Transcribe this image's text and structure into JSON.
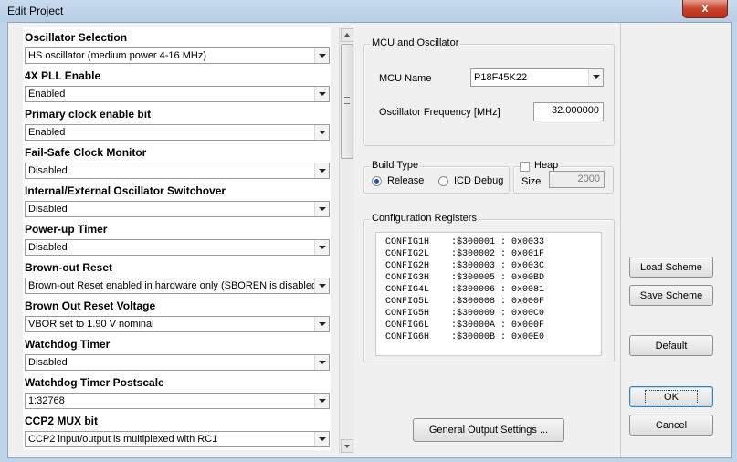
{
  "window": {
    "title": "Edit Project",
    "close_label": "x"
  },
  "options": [
    {
      "label": "Oscillator Selection",
      "value": "HS oscillator (medium power 4-16 MHz)"
    },
    {
      "label": "4X PLL Enable",
      "value": "Enabled"
    },
    {
      "label": "Primary clock enable bit",
      "value": "Enabled"
    },
    {
      "label": "Fail-Safe Clock Monitor",
      "value": "Disabled"
    },
    {
      "label": "Internal/External Oscillator Switchover",
      "value": "Disabled"
    },
    {
      "label": "Power-up Timer",
      "value": "Disabled"
    },
    {
      "label": "Brown-out Reset",
      "value": "Brown-out Reset enabled in hardware only (SBOREN is disabled)"
    },
    {
      "label": "Brown Out Reset Voltage",
      "value": "VBOR set to 1.90 V nominal"
    },
    {
      "label": "Watchdog Timer",
      "value": "Disabled"
    },
    {
      "label": "Watchdog Timer Postscale",
      "value": "1:32768"
    },
    {
      "label": "CCP2 MUX bit",
      "value": "CCP2 input/output is multiplexed with RC1"
    }
  ],
  "mcu": {
    "group_title": "MCU and Oscillator",
    "name_label": "MCU Name",
    "name_value": "P18F45K22",
    "freq_label": "Oscillator Frequency [MHz]",
    "freq_value": "32.000000"
  },
  "build": {
    "group_title": "Build Type",
    "release_label": "Release",
    "debug_label": "ICD Debug",
    "selected": "Release"
  },
  "heap": {
    "label": "Heap",
    "size_label": "Size",
    "size_value": "2000",
    "checked": false
  },
  "config": {
    "group_title": "Configuration Registers",
    "rows": [
      "CONFIG1H    :$300001 : 0x0033",
      "CONFIG2L    :$300002 : 0x001F",
      "CONFIG2H    :$300003 : 0x003C",
      "CONFIG3H    :$300005 : 0x00BD",
      "CONFIG4L    :$300006 : 0x0081",
      "CONFIG5L    :$300008 : 0x000F",
      "CONFIG5H    :$300009 : 0x00C0",
      "CONFIG6L    :$30000A : 0x000F",
      "CONFIG6H    :$30000B : 0x00E0"
    ]
  },
  "buttons": {
    "general_output": "General Output Settings ...",
    "load_scheme": "Load Scheme",
    "save_scheme": "Save Scheme",
    "default": "Default",
    "ok": "OK",
    "cancel": "Cancel"
  }
}
